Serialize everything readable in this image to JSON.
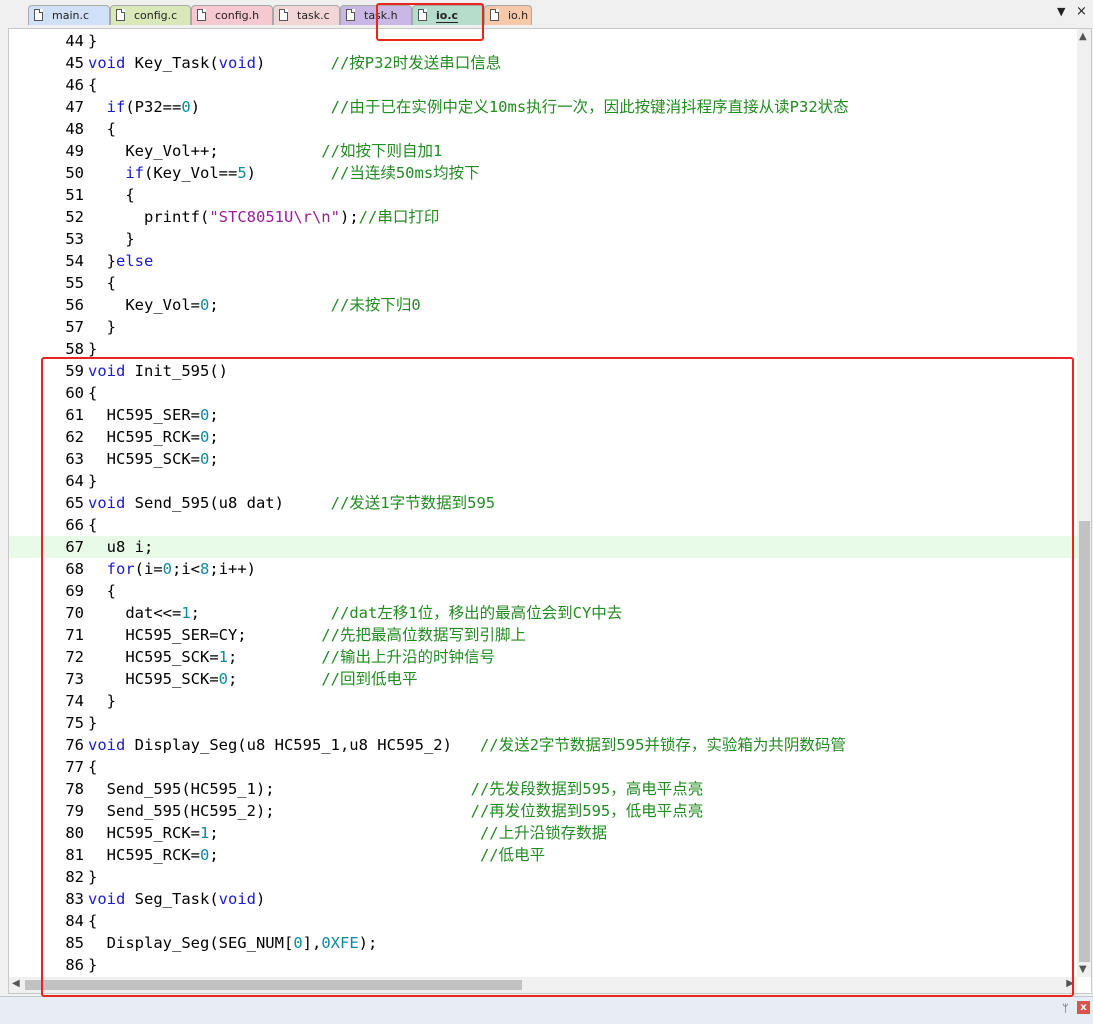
{
  "tabs": [
    {
      "label": "main.c",
      "color": "#cfe0f7",
      "active": false
    },
    {
      "label": "config.c",
      "color": "#d8e8b8",
      "active": false
    },
    {
      "label": "config.h",
      "color": "#f7c8cf",
      "active": false
    },
    {
      "label": "task.c",
      "color": "#f2d6d6",
      "active": false
    },
    {
      "label": "task.h",
      "color": "#c9b8e6",
      "active": false
    },
    {
      "label": "io.c",
      "color": "#b6dccc",
      "active": true
    },
    {
      "label": "io.h",
      "color": "#f7c9a8",
      "active": false
    }
  ],
  "tab_controls": {
    "dropdown": "▼",
    "close": "×"
  },
  "editor": {
    "current_line": 67,
    "lines": [
      {
        "n": "44",
        "segs": [
          [
            "}",
            ""
          ]
        ]
      },
      {
        "n": "45",
        "segs": [
          [
            "void",
            "kw"
          ],
          [
            " Key_Task(",
            ""
          ],
          [
            "void",
            "kw"
          ],
          [
            ")       ",
            ""
          ],
          [
            "//按P32时发送串口信息",
            "cm"
          ]
        ]
      },
      {
        "n": "46",
        "segs": [
          [
            "{",
            ""
          ]
        ]
      },
      {
        "n": "47",
        "segs": [
          [
            "  ",
            ""
          ],
          [
            "if",
            "kw"
          ],
          [
            "(P32==",
            ""
          ],
          [
            "0",
            "num"
          ],
          [
            ")              ",
            ""
          ],
          [
            "//由于已在实例中定义10ms执行一次，因此按键消抖程序直接从读P32状态",
            "cm"
          ]
        ]
      },
      {
        "n": "48",
        "segs": [
          [
            "  {",
            ""
          ]
        ]
      },
      {
        "n": "49",
        "segs": [
          [
            "    Key_Vol++;           ",
            ""
          ],
          [
            "//如按下则自加1",
            "cm"
          ]
        ]
      },
      {
        "n": "50",
        "segs": [
          [
            "    ",
            ""
          ],
          [
            "if",
            "kw"
          ],
          [
            "(Key_Vol==",
            ""
          ],
          [
            "5",
            "num"
          ],
          [
            ")        ",
            ""
          ],
          [
            "//当连续50ms均按下",
            "cm"
          ]
        ]
      },
      {
        "n": "51",
        "segs": [
          [
            "    {",
            ""
          ]
        ]
      },
      {
        "n": "52",
        "segs": [
          [
            "      printf(",
            ""
          ],
          [
            "\"STC8051U\\r\\n\"",
            "str"
          ],
          [
            ");",
            ""
          ],
          [
            "//串口打印",
            "cm"
          ]
        ]
      },
      {
        "n": "53",
        "segs": [
          [
            "    }",
            ""
          ]
        ]
      },
      {
        "n": "54",
        "segs": [
          [
            "  }",
            ""
          ],
          [
            "else",
            "kw"
          ]
        ]
      },
      {
        "n": "55",
        "segs": [
          [
            "  {",
            ""
          ]
        ]
      },
      {
        "n": "56",
        "segs": [
          [
            "    Key_Vol=",
            ""
          ],
          [
            "0",
            "num"
          ],
          [
            ";            ",
            ""
          ],
          [
            "//未按下归0",
            "cm"
          ]
        ]
      },
      {
        "n": "57",
        "segs": [
          [
            "  }",
            ""
          ]
        ]
      },
      {
        "n": "58",
        "segs": [
          [
            "}",
            ""
          ]
        ]
      },
      {
        "n": "59",
        "segs": [
          [
            "void",
            "kw"
          ],
          [
            " Init_595()",
            ""
          ]
        ]
      },
      {
        "n": "60",
        "segs": [
          [
            "{",
            ""
          ]
        ]
      },
      {
        "n": "61",
        "segs": [
          [
            "  HC595_SER=",
            ""
          ],
          [
            "0",
            "num"
          ],
          [
            ";",
            ""
          ]
        ]
      },
      {
        "n": "62",
        "segs": [
          [
            "  HC595_RCK=",
            ""
          ],
          [
            "0",
            "num"
          ],
          [
            ";",
            ""
          ]
        ]
      },
      {
        "n": "63",
        "segs": [
          [
            "  HC595_SCK=",
            ""
          ],
          [
            "0",
            "num"
          ],
          [
            ";",
            ""
          ]
        ]
      },
      {
        "n": "64",
        "segs": [
          [
            "}",
            ""
          ]
        ]
      },
      {
        "n": "65",
        "segs": [
          [
            "void",
            "kw"
          ],
          [
            " Send_595(u8 dat)     ",
            ""
          ],
          [
            "//发送1字节数据到595",
            "cm"
          ]
        ]
      },
      {
        "n": "66",
        "segs": [
          [
            "{",
            ""
          ]
        ]
      },
      {
        "n": "67",
        "segs": [
          [
            "  u8 i;",
            ""
          ]
        ]
      },
      {
        "n": "68",
        "segs": [
          [
            "  ",
            ""
          ],
          [
            "for",
            "kw"
          ],
          [
            "(i=",
            ""
          ],
          [
            "0",
            "num"
          ],
          [
            ";i<",
            ""
          ],
          [
            "8",
            "num"
          ],
          [
            ";i++)",
            ""
          ]
        ]
      },
      {
        "n": "69",
        "segs": [
          [
            "  {",
            ""
          ]
        ]
      },
      {
        "n": "70",
        "segs": [
          [
            "    dat<<=",
            ""
          ],
          [
            "1",
            "num"
          ],
          [
            ";              ",
            ""
          ],
          [
            "//dat左移1位，移出的最高位会到CY中去",
            "cm"
          ]
        ]
      },
      {
        "n": "71",
        "segs": [
          [
            "    HC595_SER=CY;        ",
            ""
          ],
          [
            "//先把最高位数据写到引脚上",
            "cm"
          ]
        ]
      },
      {
        "n": "72",
        "segs": [
          [
            "    HC595_SCK=",
            ""
          ],
          [
            "1",
            "num"
          ],
          [
            ";         ",
            ""
          ],
          [
            "//输出上升沿的时钟信号",
            "cm"
          ]
        ]
      },
      {
        "n": "73",
        "segs": [
          [
            "    HC595_SCK=",
            ""
          ],
          [
            "0",
            "num"
          ],
          [
            ";         ",
            ""
          ],
          [
            "//回到低电平",
            "cm"
          ]
        ]
      },
      {
        "n": "74",
        "segs": [
          [
            "  }",
            ""
          ]
        ]
      },
      {
        "n": "75",
        "segs": [
          [
            "}",
            ""
          ]
        ]
      },
      {
        "n": "76",
        "segs": [
          [
            "void",
            "kw"
          ],
          [
            " Display_Seg(u8 HC595_1,u8 HC595_2)   ",
            ""
          ],
          [
            "//发送2字节数据到595并锁存，实验箱为共阴数码管",
            "cm"
          ]
        ]
      },
      {
        "n": "77",
        "segs": [
          [
            "{",
            ""
          ]
        ]
      },
      {
        "n": "78",
        "segs": [
          [
            "  Send_595(HC595_1);                     ",
            ""
          ],
          [
            "//先发段数据到595，高电平点亮",
            "cm"
          ]
        ]
      },
      {
        "n": "79",
        "segs": [
          [
            "  Send_595(HC595_2);                     ",
            ""
          ],
          [
            "//再发位数据到595，低电平点亮",
            "cm"
          ]
        ]
      },
      {
        "n": "80",
        "segs": [
          [
            "  HC595_RCK=",
            ""
          ],
          [
            "1",
            "num"
          ],
          [
            ";                            ",
            ""
          ],
          [
            "//上升沿锁存数据",
            "cm"
          ]
        ]
      },
      {
        "n": "81",
        "segs": [
          [
            "  HC595_RCK=",
            ""
          ],
          [
            "0",
            "num"
          ],
          [
            ";                            ",
            ""
          ],
          [
            "//低电平",
            "cm"
          ]
        ]
      },
      {
        "n": "82",
        "segs": [
          [
            "}",
            ""
          ]
        ]
      },
      {
        "n": "83",
        "segs": [
          [
            "void",
            "kw"
          ],
          [
            " Seg_Task(",
            ""
          ],
          [
            "void",
            "kw"
          ],
          [
            ")",
            ""
          ]
        ]
      },
      {
        "n": "84",
        "segs": [
          [
            "{",
            ""
          ]
        ]
      },
      {
        "n": "85",
        "segs": [
          [
            "  Display_Seg(SEG_NUM[",
            ""
          ],
          [
            "0",
            "num"
          ],
          [
            "],",
            ""
          ],
          [
            "0XFE",
            "num"
          ],
          [
            ");",
            ""
          ]
        ]
      },
      {
        "n": "86",
        "segs": [
          [
            "}",
            ""
          ]
        ]
      }
    ]
  },
  "scroll": {
    "vertical_position": 0.52,
    "vertical_visible": 0.48,
    "horizontal_visible": 0.48
  },
  "bottom_bar": {
    "pin": "ᛘ",
    "close": "x"
  }
}
